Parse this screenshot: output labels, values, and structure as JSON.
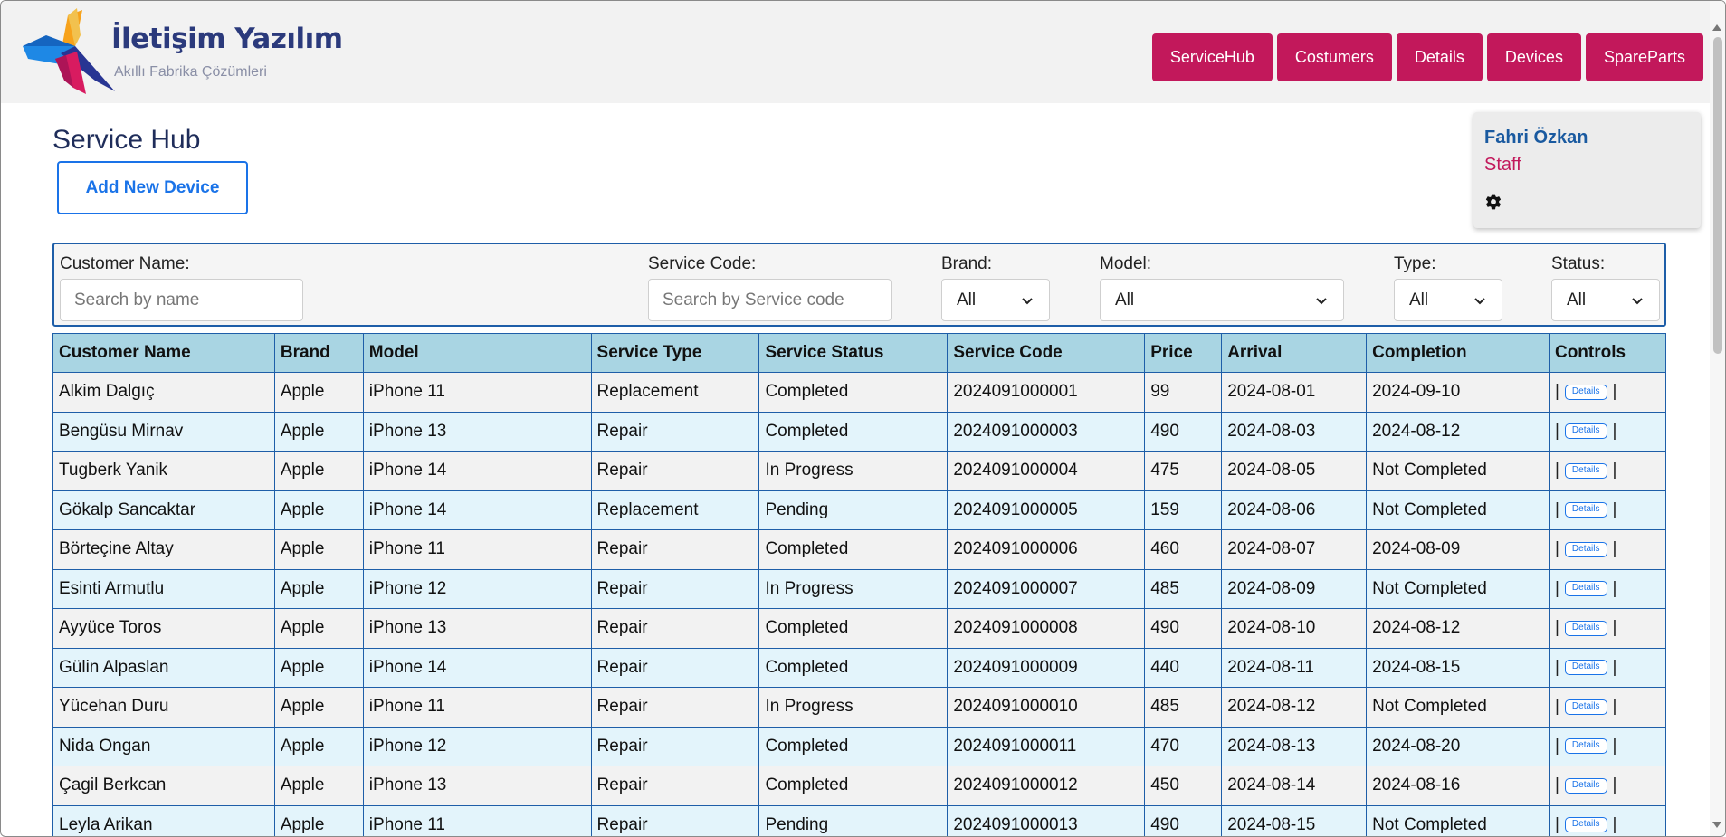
{
  "brand": {
    "title": "İletişim Yazılım",
    "subtitle": "Akıllı Fabrika Çözümleri",
    "colors": {
      "primary": "#c2185b",
      "accent": "#1a73e8",
      "navy": "#2b3a7c"
    }
  },
  "nav": [
    "ServiceHub",
    "Costumers",
    "Details",
    "Devices",
    "SpareParts"
  ],
  "page": {
    "title": "Service Hub",
    "add_button": "Add New Device"
  },
  "user": {
    "name": "Fahri Özkan",
    "role": "Staff",
    "settings_icon": "gear-icon"
  },
  "filters": {
    "customer_label": "Customer Name:",
    "customer_placeholder": "Search by name",
    "service_code_label": "Service Code:",
    "service_code_placeholder": "Search by Service code",
    "brand_label": "Brand:",
    "brand_value": "All",
    "model_label": "Model:",
    "model_value": "All",
    "type_label": "Type:",
    "type_value": "All",
    "status_label": "Status:",
    "status_value": "All"
  },
  "table": {
    "columns": [
      "Customer Name",
      "Brand",
      "Model",
      "Service Type",
      "Service Status",
      "Service Code",
      "Price",
      "Arrival",
      "Completion",
      "Controls"
    ],
    "details_label": "Details",
    "separator": "|",
    "rows": [
      [
        "Alkim Dalgıç",
        "Apple",
        "iPhone 11",
        "Replacement",
        "Completed",
        "2024091000001",
        "99",
        "2024-08-01",
        "2024-09-10"
      ],
      [
        "Bengüsu Mirnav",
        "Apple",
        "iPhone 13",
        "Repair",
        "Completed",
        "2024091000003",
        "490",
        "2024-08-03",
        "2024-08-12"
      ],
      [
        "Tugberk Yanik",
        "Apple",
        "iPhone 14",
        "Repair",
        "In Progress",
        "2024091000004",
        "475",
        "2024-08-05",
        "Not Completed"
      ],
      [
        "Gökalp Sancaktar",
        "Apple",
        "iPhone 14",
        "Replacement",
        "Pending",
        "2024091000005",
        "159",
        "2024-08-06",
        "Not Completed"
      ],
      [
        "Börteçine Altay",
        "Apple",
        "iPhone 11",
        "Repair",
        "Completed",
        "2024091000006",
        "460",
        "2024-08-07",
        "2024-08-09"
      ],
      [
        "Esinti Armutlu",
        "Apple",
        "iPhone 12",
        "Repair",
        "In Progress",
        "2024091000007",
        "485",
        "2024-08-09",
        "Not Completed"
      ],
      [
        "Ayyüce Toros",
        "Apple",
        "iPhone 13",
        "Repair",
        "Completed",
        "2024091000008",
        "490",
        "2024-08-10",
        "2024-08-12"
      ],
      [
        "Gülin Alpaslan",
        "Apple",
        "iPhone 14",
        "Repair",
        "Completed",
        "2024091000009",
        "440",
        "2024-08-11",
        "2024-08-15"
      ],
      [
        "Yücehan Duru",
        "Apple",
        "iPhone 11",
        "Repair",
        "In Progress",
        "2024091000010",
        "485",
        "2024-08-12",
        "Not Completed"
      ],
      [
        "Nida Ongan",
        "Apple",
        "iPhone 12",
        "Repair",
        "Completed",
        "2024091000011",
        "470",
        "2024-08-13",
        "2024-08-20"
      ],
      [
        "Çagil Berkcan",
        "Apple",
        "iPhone 13",
        "Repair",
        "Completed",
        "2024091000012",
        "450",
        "2024-08-14",
        "2024-08-16"
      ],
      [
        "Leyla Arikan",
        "Apple",
        "iPhone 11",
        "Repair",
        "Pending",
        "2024091000013",
        "490",
        "2024-08-15",
        "Not Completed"
      ]
    ]
  }
}
